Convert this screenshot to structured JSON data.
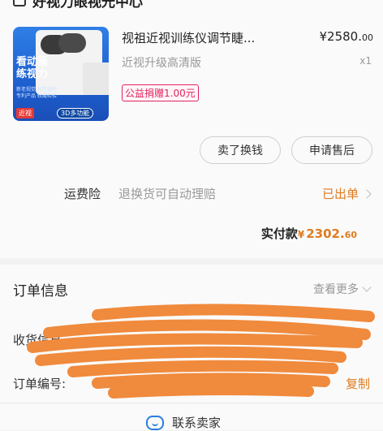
{
  "shop": {
    "name": "好视力眼视光中心"
  },
  "product": {
    "title": "视祖近视训练仪调节睫...",
    "price_main": "¥2580.",
    "price_cents": "00",
    "variant": "近视升级高清版",
    "quantity": "x1",
    "charity_tag": "公益捐赠1.00元",
    "thumb": {
      "headline": "看动画\n练视力",
      "fineprint": "新老视觉 科学调控 专利产品 权威检验",
      "badge_red": "近视",
      "badge_3d": "3D多功能"
    }
  },
  "actions": {
    "sell": "卖了换钱",
    "after_sale": "申请售后"
  },
  "insurance": {
    "label": "运费险",
    "desc": "退换货可自动理赔",
    "status": "已出单"
  },
  "payment": {
    "label": "实付款",
    "symbol": "¥",
    "amount": "2302.",
    "cents": "60"
  },
  "order_info": {
    "title": "订单信息",
    "view_more": "查看更多",
    "address_label": "收货信息",
    "address_value": "",
    "order_no_label": "订单编号:",
    "order_no_value": "",
    "copy": "复制",
    "contact": "联系卖家"
  },
  "colors": {
    "accent_orange": "#e07b1f",
    "charity_pink": "#e0245e",
    "scribble": "#f08a3c"
  }
}
